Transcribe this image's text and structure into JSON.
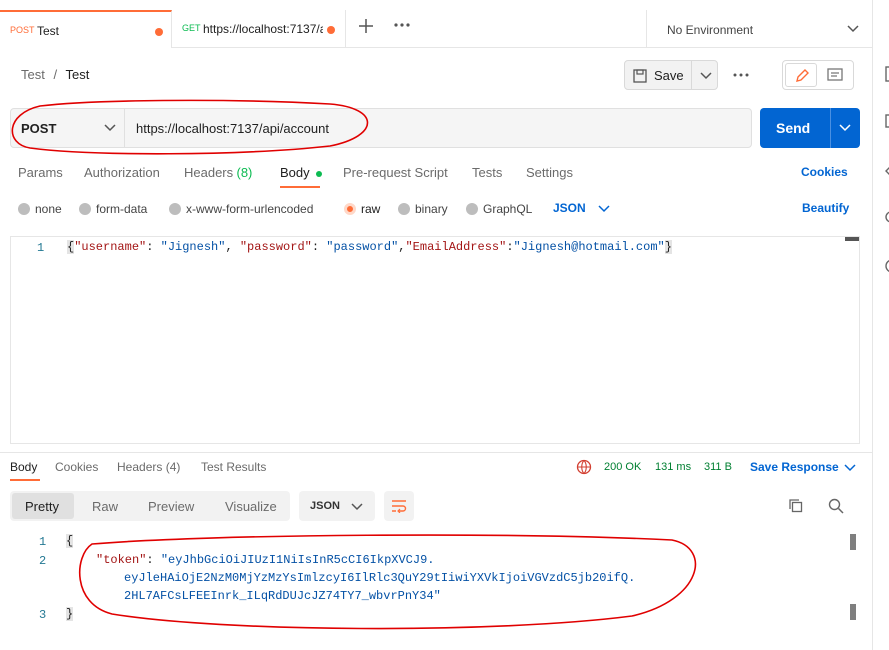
{
  "tabs": [
    {
      "method": "POST",
      "name": "Test"
    },
    {
      "method": "GET",
      "name": "https://localhost:7137/a"
    }
  ],
  "environment": "No Environment",
  "breadcrumb": {
    "collection": "Test",
    "separator": "/",
    "request": "Test"
  },
  "save_label": "Save",
  "request": {
    "method": "POST",
    "url": "https://localhost:7137/api/account",
    "send_label": "Send"
  },
  "request_tabs": [
    {
      "label": "Params",
      "count": ""
    },
    {
      "label": "Authorization",
      "count": ""
    },
    {
      "label": "Headers",
      "count": "(8)"
    },
    {
      "label": "Body",
      "count": ""
    },
    {
      "label": "Pre-request Script",
      "count": ""
    },
    {
      "label": "Tests",
      "count": ""
    },
    {
      "label": "Settings",
      "count": ""
    }
  ],
  "cookies_label": "Cookies",
  "body_types": [
    "none",
    "form-data",
    "x-www-form-urlencoded",
    "raw",
    "binary",
    "GraphQL"
  ],
  "body_format": "JSON",
  "beautify_label": "Beautify",
  "editor": {
    "line_no": "1",
    "parts": [
      "{",
      "\"username\"",
      ":",
      " ",
      "\"Jignesh\"",
      ", ",
      "\"password\"",
      ":",
      " ",
      "\"password\"",
      ",",
      "\"EmailAddress\"",
      ":",
      "\"Jignesh@hotmail.com\"",
      "}"
    ]
  },
  "response_tabs": [
    {
      "label": "Body",
      "count": ""
    },
    {
      "label": "Cookies",
      "count": ""
    },
    {
      "label": "Headers",
      "count": "(4)"
    },
    {
      "label": "Test Results",
      "count": ""
    }
  ],
  "response_status": {
    "status": "200 OK",
    "time": "131 ms",
    "size": "311 B"
  },
  "save_response_label": "Save Response",
  "view_modes": [
    "Pretty",
    "Raw",
    "Preview",
    "Visualize"
  ],
  "response_format": "JSON",
  "response": {
    "line1": "{",
    "line2_no": "2",
    "line1_no": "1",
    "line3_no": "3",
    "key": "\"token\"",
    "colon": ": ",
    "token_lines": [
      "\"eyJhbGciOiJIUzI1NiIsInR5cCI6IkpXVCJ9.",
      "eyJleHAiOjE2NzM0MjYzMzYsImlzcyI6IlRlc3QuY29tIiwiYXVkIjoiVGVzdC5jb20ifQ.",
      "2HL7AFCsLFEEInrk_ILqRdDUJcJZ74TY7_wbvrPnY34\""
    ],
    "line3": "}"
  },
  "colors": {
    "accent": "#ff6c37",
    "send": "#0265d2",
    "link": "#0265d2",
    "status_ok": "#007f31",
    "annotation": "#e00000"
  }
}
